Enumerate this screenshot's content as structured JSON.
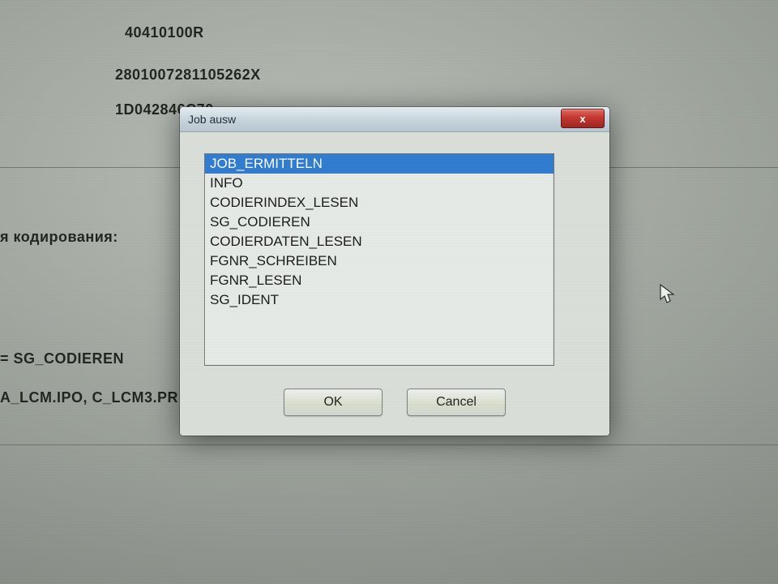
{
  "background": {
    "line1": "40410100R",
    "line2": "2801007281105262X",
    "line3": "1D042846C70",
    "label_coding": "я кодирования:",
    "eq_line": "= SG_CODIEREN",
    "file_line": "A_LCM.IPO, C_LCM3.PR"
  },
  "dialog": {
    "title": "Job ausw",
    "close_glyph": "x",
    "ok_label": "OK",
    "cancel_label": "Cancel",
    "items": {
      "0": "JOB_ERMITTELN",
      "1": "INFO",
      "2": "CODIERINDEX_LESEN",
      "3": "SG_CODIEREN",
      "4": "CODIERDATEN_LESEN",
      "5": "FGNR_SCHREIBEN",
      "6": "FGNR_LESEN",
      "7": "SG_IDENT"
    }
  }
}
